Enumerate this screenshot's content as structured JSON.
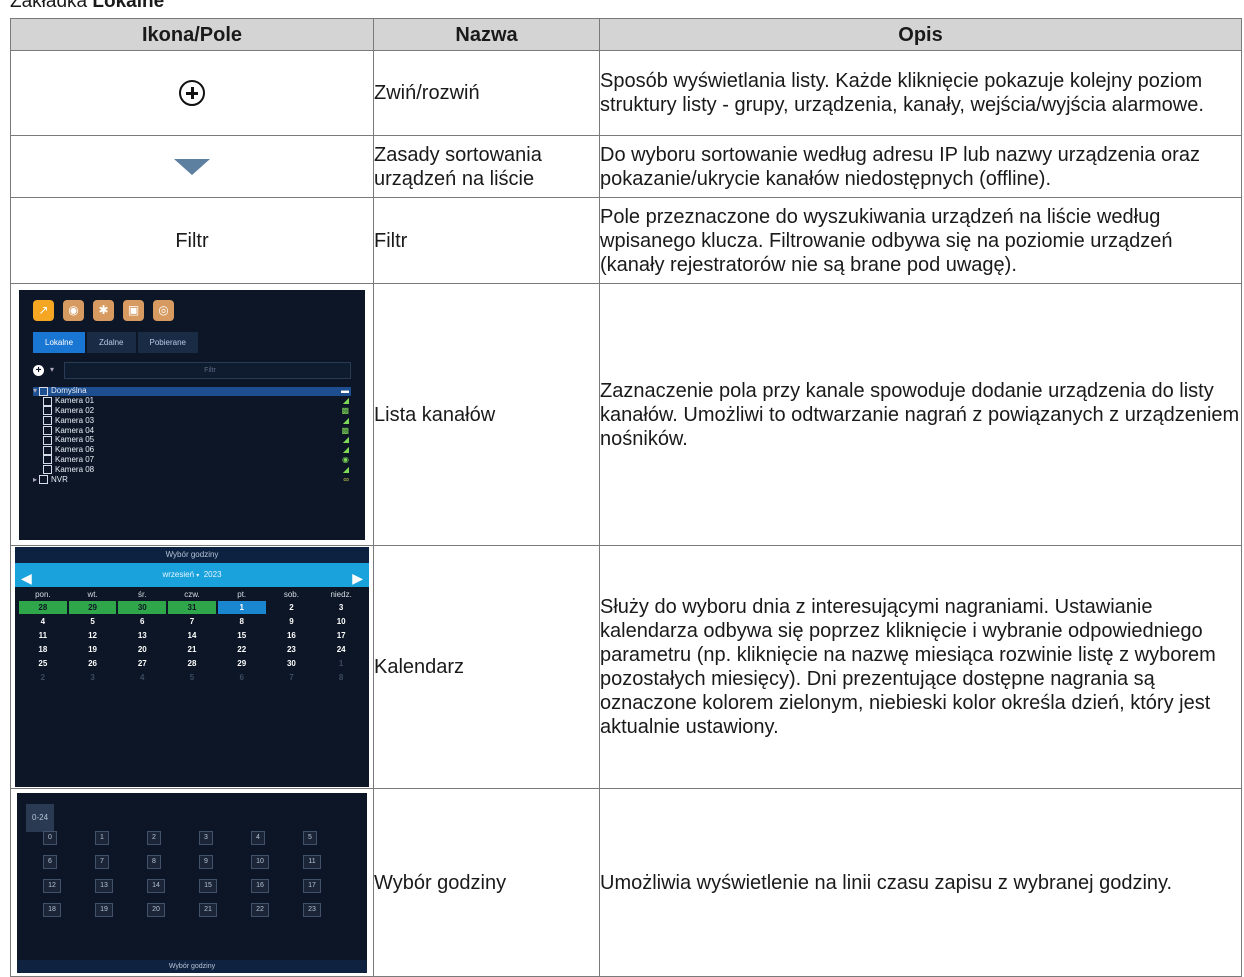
{
  "caption": {
    "prefix": "Zakładka ",
    "bold": "Lokalne"
  },
  "headers": [
    "Ikona/Pole",
    "Nazwa",
    "Opis"
  ],
  "rows": [
    {
      "icon": "plus-circle-icon",
      "name": "Zwiń/rozwiń",
      "desc": "Sposób wyświetlania listy. Każde kliknięcie pokazuje kolejny poziom struktury listy - grupy, urządzenia, kanały, wejścia/wyjścia alarmowe."
    },
    {
      "icon": "triangle-down-icon",
      "name": "Zasady sortowania urządzeń na liście",
      "desc": "Do wyboru sortowanie według adresu IP lub nazwy urządzenia oraz pokazanie/ukrycie kanałów niedostępnych (offline)."
    },
    {
      "field": "Filtr",
      "name": "Filtr",
      "desc": "Pole przeznaczone do wyszukiwania urządzeń na liście według wpisanego klucza. Filtrowanie odbywa się na poziomie urządzeń (kanały rejestratorów nie są brane pod uwagę)."
    },
    {
      "name": "Lista kanałów",
      "desc": "Zaznaczenie pola przy kanale spowoduje dodanie urządzenia do listy kanałów. Umożliwi to odtwarzanie nagrań z powiązanych z urządzeniem nośników."
    },
    {
      "name": "Kalendarz",
      "desc": "Służy do wyboru dnia z interesującymi nagraniami. Ustawianie kalendarza odbywa się poprzez kliknięcie i wybranie odpowiedniego parametru (np. kliknięcie na nazwę miesiąca rozwinie listę z wyborem pozostałych miesięcy). Dni prezentujące dostępne nagrania są oznaczone kolorem zielonym, niebieski kolor określa dzień, który jest aktualnie ustawiony."
    },
    {
      "name": "Wybór godziny",
      "desc": "Umożliwia wyświetlenie na linii czasu zapisu z wybranej godziny."
    }
  ],
  "shot_channels": {
    "tabs": [
      "Lokalne",
      "Zdalne",
      "Pobierane"
    ],
    "filter_placeholder": "Filtr",
    "group": "Domyślna",
    "cameras": [
      "Kamera 01",
      "Kamera 02",
      "Kamera 03",
      "Kamera 04",
      "Kamera 05",
      "Kamera 06",
      "Kamera 07",
      "Kamera 08"
    ],
    "nvr": "NVR"
  },
  "shot_calendar": {
    "title": "Wybór godziny",
    "month": "wrzesień",
    "year": "2023",
    "weekdays": [
      "pon.",
      "wt.",
      "śr.",
      "czw.",
      "pt.",
      "sob.",
      "niedz."
    ],
    "weeks": [
      [
        "28",
        "29",
        "30",
        "31",
        "1",
        "2",
        "3"
      ],
      [
        "4",
        "5",
        "6",
        "7",
        "8",
        "9",
        "10"
      ],
      [
        "11",
        "12",
        "13",
        "14",
        "15",
        "16",
        "17"
      ],
      [
        "18",
        "19",
        "20",
        "21",
        "22",
        "23",
        "24"
      ],
      [
        "25",
        "26",
        "27",
        "28",
        "29",
        "30",
        "1"
      ],
      [
        "2",
        "3",
        "4",
        "5",
        "6",
        "7",
        "8"
      ]
    ],
    "green_days": [
      "28",
      "29",
      "30",
      "31"
    ],
    "selected_day": "1"
  },
  "shot_hours": {
    "range_tag": "0-24",
    "hours": [
      "0",
      "1",
      "2",
      "3",
      "4",
      "5",
      "6",
      "7",
      "8",
      "9",
      "10",
      "11",
      "12",
      "13",
      "14",
      "15",
      "16",
      "17",
      "18",
      "19",
      "20",
      "21",
      "22",
      "23"
    ],
    "footer": "Wybór godziny"
  },
  "colors": {
    "header_bg": "#d4d4d4",
    "screen_bg": "#0c1626",
    "accent_blue": "#1a86cf",
    "record_green": "#2fa64a"
  }
}
